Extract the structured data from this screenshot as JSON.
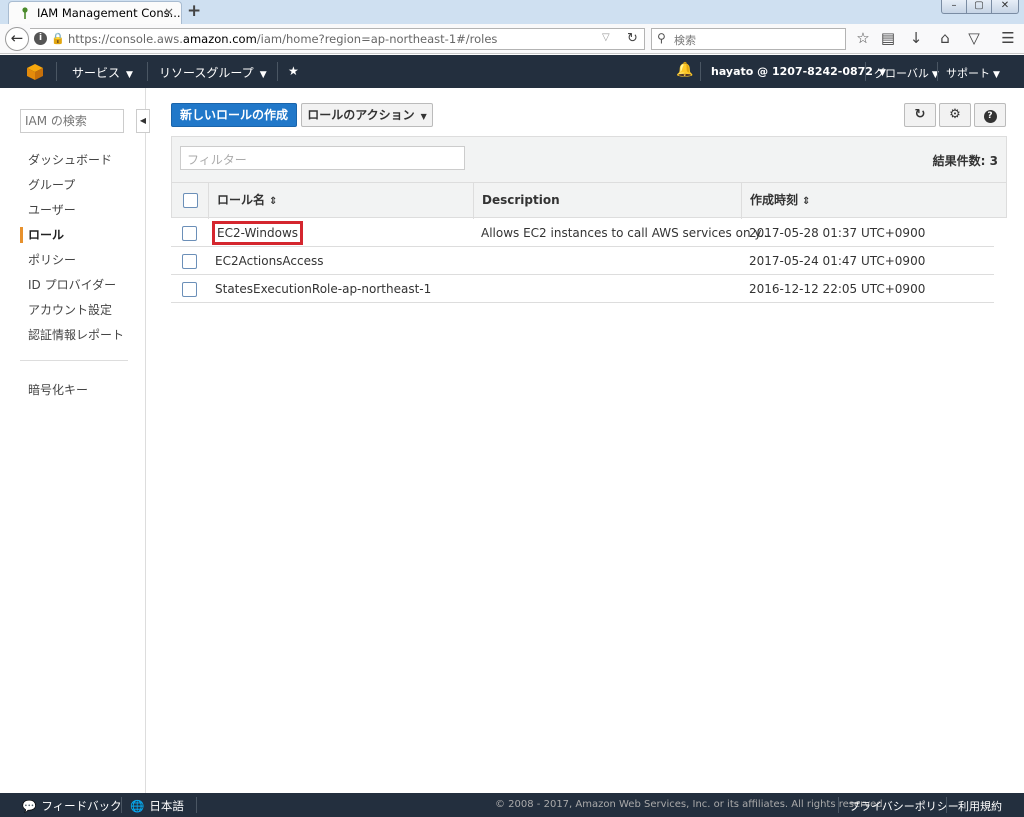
{
  "browser": {
    "tab_title": "IAM Management Cons...",
    "tab_close": "×",
    "new_tab": "+",
    "url_prefix": "https://console.aws.",
    "url_domain": "amazon.com",
    "url_path": "/iam/home?region=ap-northeast-1#/roles",
    "search_placeholder": "検索",
    "window_buttons": {
      "minimize": "–",
      "maximize": "▢",
      "close": "✕"
    }
  },
  "aws_nav": {
    "services": "サービス",
    "resource_groups": "リソースグループ",
    "account": "hayato @ 1207-8242-0872",
    "region": "グローバル",
    "support": "サポート"
  },
  "sidebar": {
    "search_placeholder": "IAM の検索",
    "items": [
      {
        "label": "ダッシュボード"
      },
      {
        "label": "グループ"
      },
      {
        "label": "ユーザー"
      },
      {
        "label": "ロール"
      },
      {
        "label": "ポリシー"
      },
      {
        "label": "ID プロバイダー"
      },
      {
        "label": "アカウント設定"
      },
      {
        "label": "認証情報レポート"
      },
      {
        "label": "暗号化キー"
      }
    ]
  },
  "toolbar": {
    "create_role": "新しいロールの作成",
    "role_actions": "ロールのアクション"
  },
  "table": {
    "filter_placeholder": "フィルター",
    "result_count": "結果件数: 3",
    "columns": {
      "name": "ロール名",
      "description": "Description",
      "created": "作成時刻"
    },
    "rows": [
      {
        "name": "EC2-Windows",
        "description": "Allows EC2 instances to call AWS services on y...",
        "created": "2017-05-28 01:37 UTC+0900"
      },
      {
        "name": "EC2ActionsAccess",
        "description": "",
        "created": "2017-05-24 01:47 UTC+0900"
      },
      {
        "name": "StatesExecutionRole-ap-northeast-1",
        "description": "",
        "created": "2016-12-12 22:05 UTC+0900"
      }
    ]
  },
  "footer": {
    "feedback": "フィードバック",
    "language": "日本語",
    "copyright": "© 2008 - 2017, Amazon Web Services, Inc. or its affiliates. All rights reserved.",
    "privacy": "プライバシーポリシー",
    "terms": "利用規約"
  },
  "colors": {
    "nav_bg": "#232f3e",
    "primary_button": "#2178c9",
    "active_marker": "#e7912d",
    "highlight_box": "#d4262e"
  }
}
